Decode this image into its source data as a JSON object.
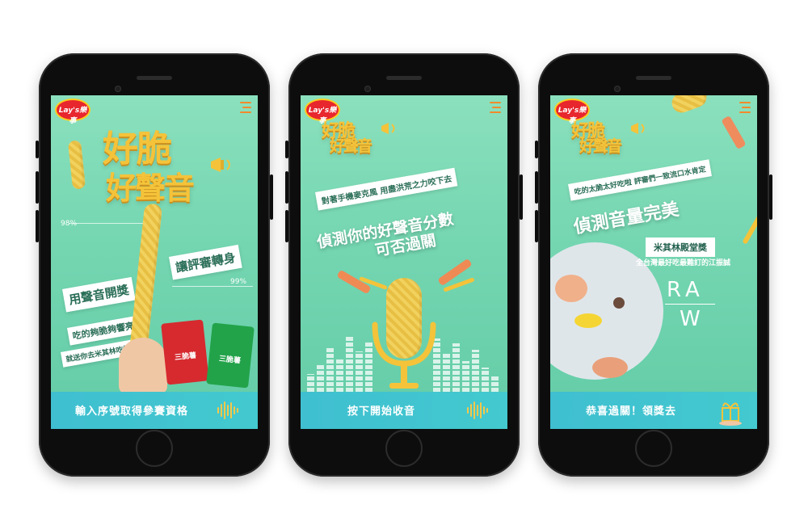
{
  "brand": {
    "logo_text": "Lay's樂事"
  },
  "screen1": {
    "title_line1": "好脆",
    "title_line2": "好聲音",
    "stat_left": "98%",
    "stat_right": "99%",
    "banner_main_a": "用聲音開獎",
    "banner_main_b": "讓評審轉身",
    "banner_sub": "吃的夠脆夠響亮",
    "banner_sub2": "就送你去米其林吃好料",
    "pack_label": "三脆薯",
    "cta": "輸入序號取得參賽資格"
  },
  "screen2": {
    "title_line1": "好脆",
    "title_line2": "好聲音",
    "banner": "對著手機麥克風 用盡洪荒之力咬下去",
    "heading_line1": "偵測你的好聲音分數",
    "heading_line2": "可否過關",
    "cta": "按下開始收音"
  },
  "screen3": {
    "title_line1": "好脆",
    "title_line2": "好聲音",
    "banner": "吃的太脆太好吃啦 評審們一致流口水肯定",
    "heading": "偵測音量完美",
    "award_title": "米其林殿堂獎",
    "award_sub": "全台灣最好吃最難訂的江振誠",
    "raw_top": "RA",
    "raw_bottom": "W",
    "cta": "恭喜過關！領獎去"
  },
  "colors": {
    "bg_mint": "#74d6b1",
    "accent_yellow": "#f4c33a",
    "bar_cyan": "#43c9cf",
    "brand_red": "#e8262d"
  }
}
